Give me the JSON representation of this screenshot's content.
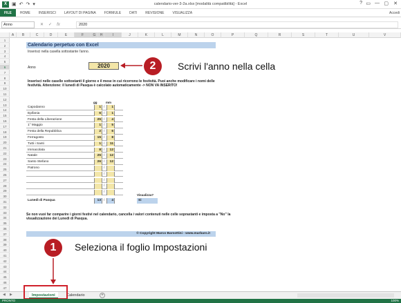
{
  "window": {
    "title": "calendario-ver-3-2a.xlsx [modalità compatibilità] - Excel",
    "app_icon": "X",
    "quick_access": [
      "save-icon",
      "undo-icon",
      "redo-icon"
    ],
    "controls": [
      "?",
      "▭",
      "—",
      "▢",
      "✕"
    ]
  },
  "ribbon": {
    "tabs": [
      "FILE",
      "HOME",
      "INSERISCI",
      "LAYOUT DI PAGINA",
      "FORMULE",
      "DATI",
      "REVISIONE",
      "VISUALIZZA"
    ],
    "account": "Accedi"
  },
  "formula_bar": {
    "name_box": "Anno",
    "fx_label": "fx",
    "value": "2020"
  },
  "column_headers": [
    "A",
    "B",
    "C",
    "D",
    "E",
    "F",
    "G",
    "H",
    "I",
    "J",
    "K",
    "L",
    "M",
    "N",
    "O",
    "P",
    "Q",
    "R",
    "S",
    "T",
    "U",
    "V"
  ],
  "row_headers": [
    "1",
    "2",
    "3",
    "4",
    "5",
    "6",
    "7",
    "8",
    "9",
    "10",
    "11",
    "12",
    "13",
    "14",
    "15",
    "16",
    "17",
    "18",
    "19",
    "20",
    "21",
    "22",
    "23",
    "24",
    "25",
    "26",
    "27",
    "28",
    "29",
    "30",
    "31",
    "32",
    "33",
    "34",
    "35",
    "36",
    "37",
    "38",
    "39",
    "40",
    "41",
    "42",
    "43",
    "44",
    "45",
    "46",
    "47"
  ],
  "sheet": {
    "title": "Calendario perpetuo con Excel",
    "subtitle": "Inserisci nella casella sottostante l'anno.",
    "anno_label": "Anno",
    "anno_value": "2020",
    "instructions": "Inserisci nelle caselle sottostanti il giorno e il mese in cui ricorrono le festività. Puoi anche modificare i nomi delle festività. Attenzione: il lunedì di Pasqua è calcolato automaticamente -> NON VA INSERITO!",
    "col_gg": "gg",
    "col_mm": "mm",
    "holidays": [
      {
        "name": "Capodanno",
        "gg": "1",
        "mm": "1"
      },
      {
        "name": "Epifania",
        "gg": "6",
        "mm": "1"
      },
      {
        "name": "Festa della Liberazione",
        "gg": "25",
        "mm": "4"
      },
      {
        "name": "1° Maggio",
        "gg": "1",
        "mm": "5"
      },
      {
        "name": "Festa della Repubblica",
        "gg": "2",
        "mm": "6"
      },
      {
        "name": "Ferragosto",
        "gg": "15",
        "mm": "8"
      },
      {
        "name": "Tutti i Santi",
        "gg": "1",
        "mm": "11"
      },
      {
        "name": "Immacolata",
        "gg": "8",
        "mm": "12"
      },
      {
        "name": "Natale",
        "gg": "25",
        "mm": "12"
      },
      {
        "name": "Santo Stefano",
        "gg": "26",
        "mm": "12"
      },
      {
        "name": "Patrono",
        "gg": "",
        "mm": ""
      },
      {
        "name": "",
        "gg": "",
        "mm": ""
      },
      {
        "name": "",
        "gg": "",
        "mm": ""
      },
      {
        "name": "",
        "gg": "",
        "mm": ""
      },
      {
        "name": "",
        "gg": "",
        "mm": ""
      }
    ],
    "pasqua": {
      "name": "Lunedì di Pasqua",
      "gg": "13",
      "mm": "4"
    },
    "visualizza_label": "Visualizza?",
    "visualizza_value": "Si",
    "footer_note": "Se non vuoi far comparire i giorni festivi nel calendario, cancella i valori contenuti nelle celle soprastanti e imposta a \"No\" la visualizzazione dei Lunedì di Pasqua.",
    "copyright": "© Copyright Marco Barsottini - www.marbaro.it"
  },
  "callouts": {
    "step1": {
      "num": "1",
      "text": "Seleziona il foglio Impostazioni"
    },
    "step2": {
      "num": "2",
      "text": "Scrivi l'anno nella cella"
    },
    "accent": "#b81d24"
  },
  "sheet_tabs": {
    "tabs": [
      "Impostazioni",
      "Calendario"
    ],
    "active": "Impostazioni",
    "add": "+"
  },
  "status": {
    "left": "PRONTO",
    "zoom": "100%"
  }
}
